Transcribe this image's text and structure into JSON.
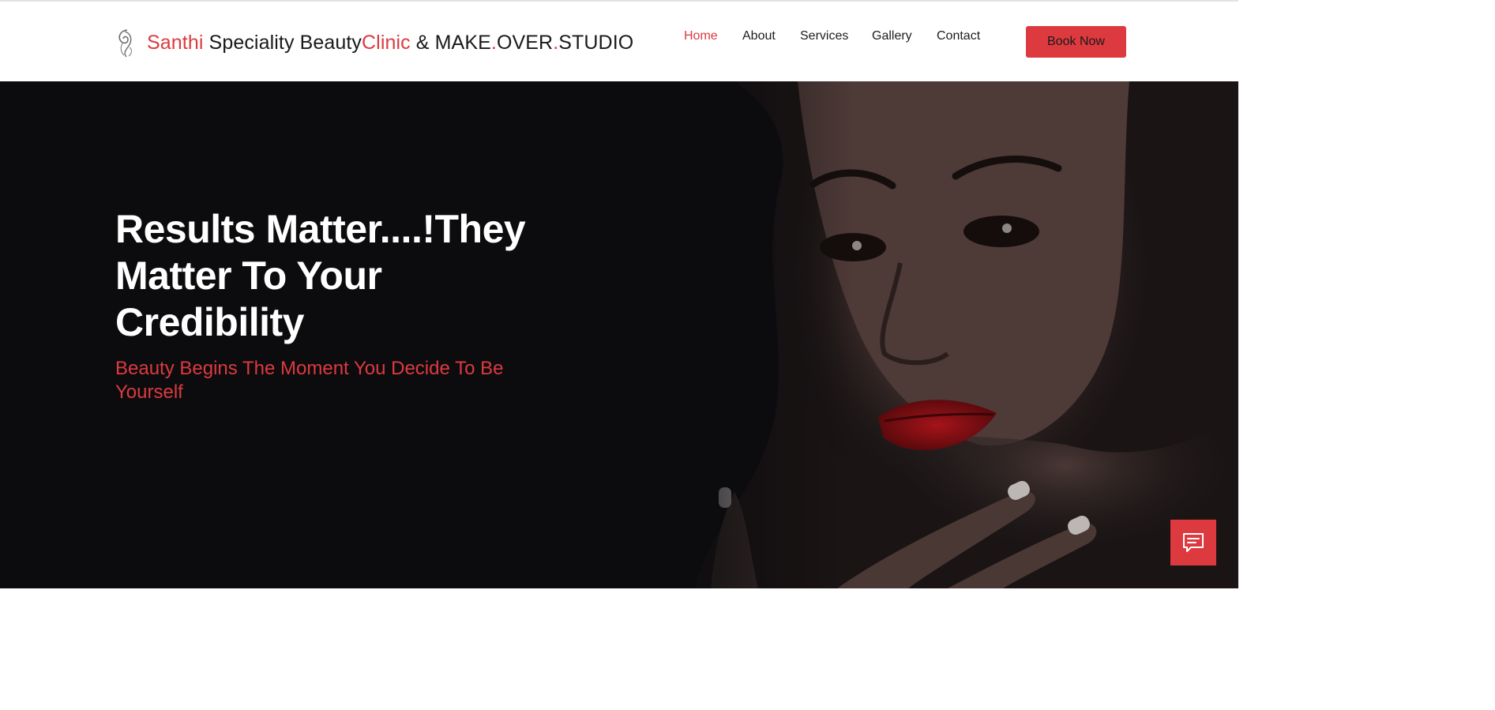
{
  "brand": {
    "logo_icon": "hair-silhouette-icon",
    "part1": "Santhi",
    "part2": " Speciality Beauty",
    "part3": "Clinic",
    "part4": " & MAKE",
    "dot1": ".",
    "part5": "OVER",
    "dot2": ".",
    "part6": "STUDIO"
  },
  "nav": {
    "items": [
      {
        "label": "Home",
        "active": true
      },
      {
        "label": "About",
        "active": false
      },
      {
        "label": "Services",
        "active": false
      },
      {
        "label": "Gallery",
        "active": false
      },
      {
        "label": "Contact",
        "active": false
      }
    ],
    "cta_label": "Book Now"
  },
  "hero": {
    "title": "Results Matter....!They Matter To Your Credibility",
    "subtitle": "Beauty Begins The Moment You Decide To Be Yourself"
  },
  "chat": {
    "icon": "chat-bubble-icon"
  },
  "colors": {
    "accent": "#dd3a3f",
    "hero_background": "#0c0c0e",
    "text_dark": "#1e1e1e",
    "text_light": "#ffffff"
  }
}
